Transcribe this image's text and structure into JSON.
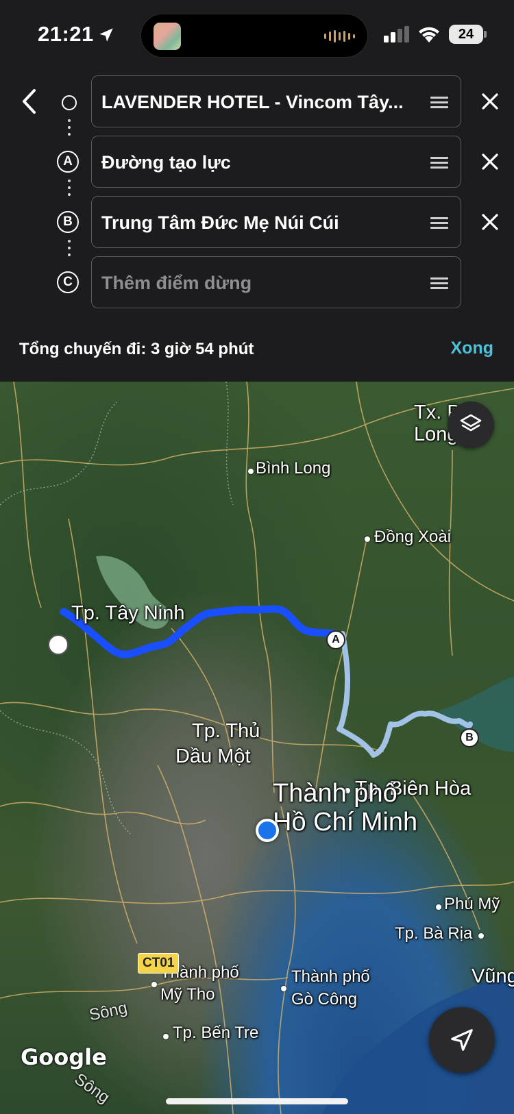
{
  "status": {
    "time": "21:21",
    "battery": "24"
  },
  "route": {
    "stops": [
      {
        "marker": "",
        "value": "LAVENDER HOTEL - Vincom Tây...",
        "placeholder": false
      },
      {
        "marker": "A",
        "value": "Đường tạo lực",
        "placeholder": false
      },
      {
        "marker": "B",
        "value": "Trung Tâm Đức Mẹ Núi Cúi",
        "placeholder": false
      },
      {
        "marker": "C",
        "value": "Thêm điểm dừng",
        "placeholder": true
      }
    ],
    "total_label": "Tổng chuyến đi: 3 giờ 54 phút",
    "done_label": "Xong"
  },
  "map": {
    "labels": {
      "tx_phuoc_long": "Tx. Phước\nLong",
      "binh_long": "Bình Long",
      "dong_xoai": "Đồng Xoài",
      "tay_ninh": "Tp. Tây Ninh",
      "thu_dau_mot_1": "Tp. Thủ",
      "thu_dau_mot_2": "Dầu Một",
      "bien_hoa": "Tp. Biên Hòa",
      "hcm_1": "Thành phố",
      "hcm_2": "Hồ Chí Minh",
      "phu_my": "Phú Mỹ",
      "ba_ria": "Tp. Bà Rịa",
      "vung_tau": "Vũng",
      "my_tho_1": "Thành phố",
      "my_tho_2": "Mỹ Tho",
      "go_cong_1": "Thành phố",
      "go_cong_2": "Gò Công",
      "ben_tre": "Tp. Bến Tre",
      "song_1": "Sông",
      "song_2": "Sông"
    },
    "road_shield": "CT01",
    "pin_a": "A",
    "pin_b": "B",
    "attribution": "Google",
    "route_color": "#1a4fff",
    "alt_route_color": "#a8c8f0"
  }
}
